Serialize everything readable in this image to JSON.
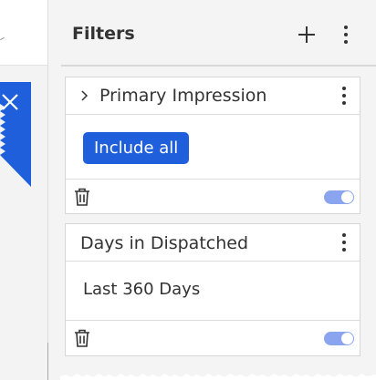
{
  "colors": {
    "accent": "#1f5fdc",
    "toggle_on": "#8aa4f0",
    "panel_bg": "#f4f4f4"
  },
  "filters_panel": {
    "title": "Filters",
    "header_icons": [
      "plus-icon",
      "more-vertical-icon"
    ]
  },
  "filter_cards": [
    {
      "title": "Primary Impression",
      "collapsed": true,
      "action_label": "Include all",
      "enabled": true
    },
    {
      "title": "Days in Dispatched",
      "value": "Last 360 Days",
      "enabled": true
    }
  ]
}
